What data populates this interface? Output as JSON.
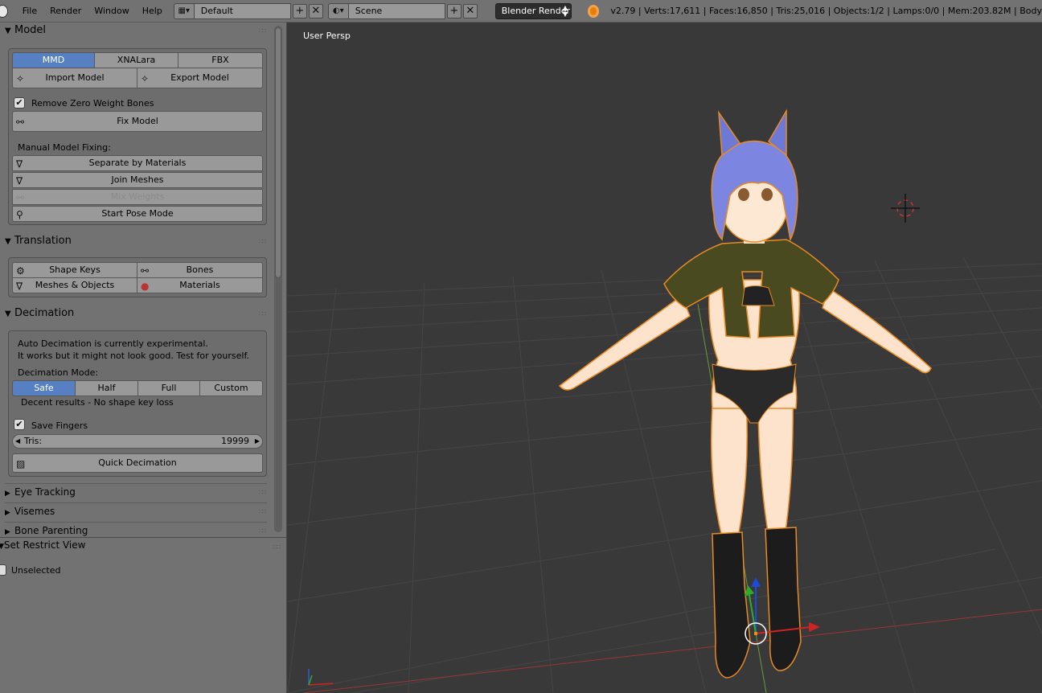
{
  "topbar": {
    "menus": [
      "File",
      "Render",
      "Window",
      "Help"
    ],
    "layout": "Default",
    "scene": "Scene",
    "engine": "Blender Render",
    "stats": "v2.79 | Verts:17,611 | Faces:16,850 | Tris:25,016 | Objects:1/2 | Lamps:0/0 | Mem:203.82M | Body"
  },
  "model": {
    "title": "Model",
    "tabs": [
      "MMD",
      "XNALara",
      "FBX"
    ],
    "import": "Import Model",
    "export": "Export Model",
    "remove_zero": "Remove Zero Weight Bones",
    "fix": "Fix Model",
    "manual_label": "Manual Model Fixing:",
    "separate": "Separate by Materials",
    "join": "Join Meshes",
    "mix": "Mix Weights",
    "pose": "Start Pose Mode"
  },
  "translation": {
    "title": "Translation",
    "shape_keys": "Shape Keys",
    "bones": "Bones",
    "meshes": "Meshes & Objects",
    "materials": "Materials"
  },
  "decimation": {
    "title": "Decimation",
    "info1": "Auto Decimation is currently experimental.",
    "info2": "It works but it might not look good. Test for yourself.",
    "mode_label": "Decimation Mode:",
    "modes": [
      "Safe",
      "Half",
      "Full",
      "Custom"
    ],
    "mode_desc": "Decent results - No shape key loss",
    "save_fingers": "Save Fingers",
    "tris_label": "Tris:",
    "tris_value": "19999",
    "quick": "Quick Decimation"
  },
  "collapsed": [
    "Eye Tracking",
    "Visemes",
    "Bone Parenting"
  ],
  "operator": {
    "title": "Set Restrict View",
    "unselected": "Unselected"
  },
  "viewport": {
    "label": "User Persp"
  }
}
